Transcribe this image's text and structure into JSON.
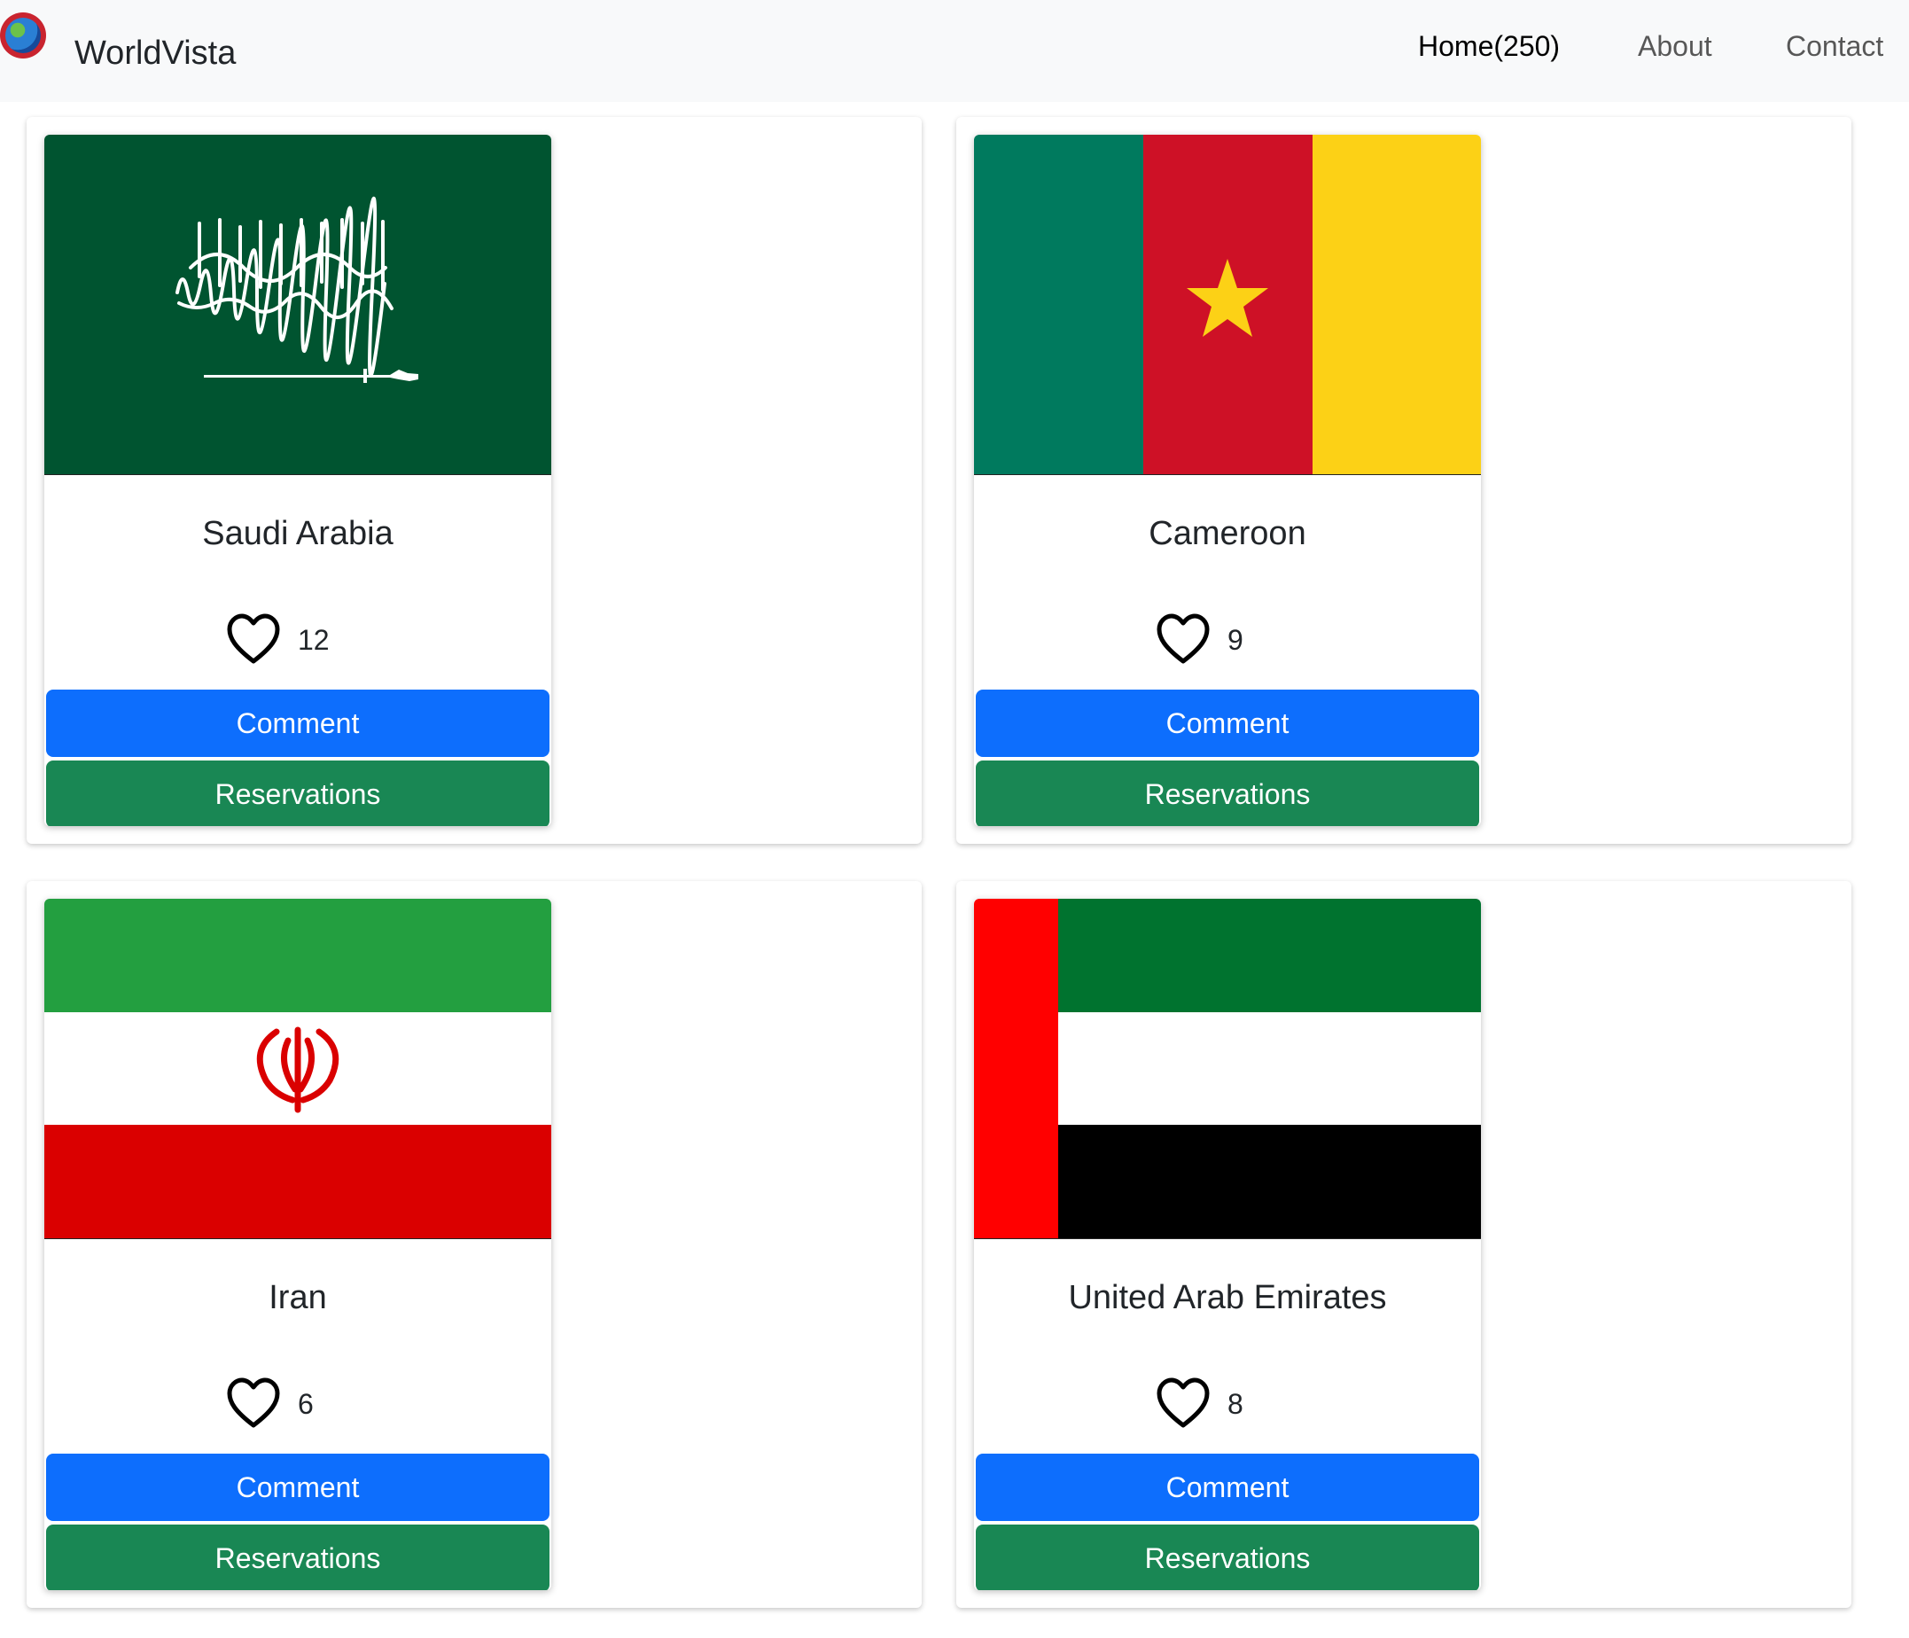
{
  "navbar": {
    "brand": "WorldVista",
    "logo_icon": "globe-logo-icon",
    "links": [
      {
        "label": "Home(250)",
        "active": true
      },
      {
        "label": "About",
        "active": false
      },
      {
        "label": "Contact",
        "active": false
      }
    ]
  },
  "countries": [
    {
      "name": "Saudi Arabia",
      "likes": "12",
      "comment_label": "Comment",
      "reservations_label": "Reservations",
      "flag_colors": [
        "#005430",
        "#ffffff"
      ]
    },
    {
      "name": "Cameroon",
      "likes": "9",
      "comment_label": "Comment",
      "reservations_label": "Reservations",
      "flag_colors": [
        "#007a5e",
        "#ce1126",
        "#fcd116"
      ]
    },
    {
      "name": "Iran",
      "likes": "6",
      "comment_label": "Comment",
      "reservations_label": "Reservations",
      "flag_colors": [
        "#239f40",
        "#ffffff",
        "#da0000"
      ]
    },
    {
      "name": "United Arab Emirates",
      "likes": "8",
      "comment_label": "Comment",
      "reservations_label": "Reservations",
      "flag_colors": [
        "#ff0000",
        "#00732f",
        "#ffffff",
        "#000000"
      ]
    }
  ],
  "colors": {
    "primary": "#0d6efd",
    "success": "#198754",
    "navbar_bg": "#f8f9fa"
  }
}
